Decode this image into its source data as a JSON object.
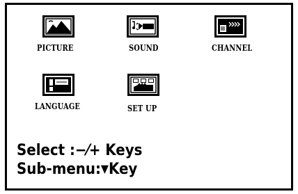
{
  "menu": {
    "items": [
      {
        "label": "PICTURE",
        "icon": "picture-icon"
      },
      {
        "label": "SOUND",
        "icon": "sound-icon"
      },
      {
        "label": "CHANNEL",
        "icon": "channel-icon"
      },
      {
        "label": "LANGUAGE",
        "icon": "language-icon"
      },
      {
        "label": "SET UP",
        "icon": "setup-icon"
      }
    ]
  },
  "hints": {
    "select_text": "Select :−⁄+ Keys",
    "submenu_prefix": "Sub-menu:",
    "submenu_arrow": "▼",
    "submenu_suffix": "Key"
  },
  "colors": {
    "foreground": "#000000",
    "background": "#ffffff"
  }
}
